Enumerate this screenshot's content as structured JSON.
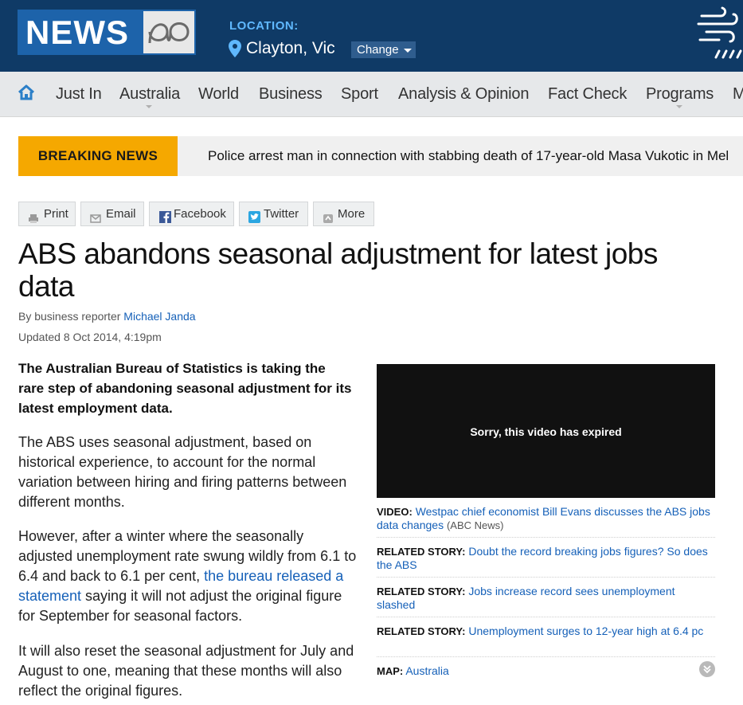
{
  "header": {
    "logo_text": "NEWS",
    "location_label": "LOCATION:",
    "location_name": "Clayton, Vic",
    "change_label": "Change"
  },
  "nav": {
    "items": [
      "Just In",
      "Australia",
      "World",
      "Business",
      "Sport",
      "Analysis & Opinion",
      "Fact Check",
      "Programs",
      "M"
    ]
  },
  "breaking": {
    "label": "BREAKING NEWS",
    "text": "Police arrest man in connection with stabbing death of 17-year-old Masa Vukotic in Mel"
  },
  "share": {
    "print": "Print",
    "email": "Email",
    "facebook": "Facebook",
    "twitter": "Twitter",
    "more": "More"
  },
  "article": {
    "headline": "ABS abandons seasonal adjustment for latest jobs data",
    "byline_prefix": "By business reporter ",
    "author": "Michael Janda",
    "updated": "Updated 8 Oct 2014, 4:19pm",
    "lead": "The Australian Bureau of Statistics is taking the rare step of abandoning seasonal adjustment for its latest employment data.",
    "p1": "The ABS uses seasonal adjustment, based on historical experience, to account for the normal variation between hiring and firing patterns between different months.",
    "p2_before": "However, after a winter where the seasonally adjusted unemployment rate swung wildly from 6.1 to 6.4 and back to 6.1 per cent, ",
    "p2_link": "the bureau released a statement",
    "p2_after": " saying it will not adjust the original figure for September for seasonal factors.",
    "p3": "It will also reset the seasonal adjustment for July and August to one, meaning that these months will also reflect the original figures."
  },
  "sidebar": {
    "video_message": "Sorry, this video has expired",
    "video_label": "VIDEO:",
    "video_link": "Westpac chief economist Bill Evans discusses the ABS jobs data changes",
    "video_source": "(ABC News)",
    "related_label": "RELATED STORY:",
    "related": [
      "Doubt the record breaking jobs figures? So does the ABS",
      "Jobs increase record sees unemployment slashed",
      "Unemployment surges to 12-year high at 6.4 pc"
    ],
    "map_label": "MAP:",
    "map_link": "Australia"
  },
  "colors": {
    "header_bg": "#0f3a66",
    "logo_bg": "#1d63aa",
    "location_label": "#5fb8ff",
    "breaking_label_bg": "#f5a800",
    "link": "#1560b8",
    "nav_bg": "#e6e8ea"
  },
  "icons": [
    "map-pin-icon",
    "abc-logo-icon",
    "weather-wind-icon",
    "home-icon",
    "print-icon",
    "email-icon",
    "facebook-icon",
    "twitter-icon",
    "more-share-icon",
    "expand-icon"
  ]
}
